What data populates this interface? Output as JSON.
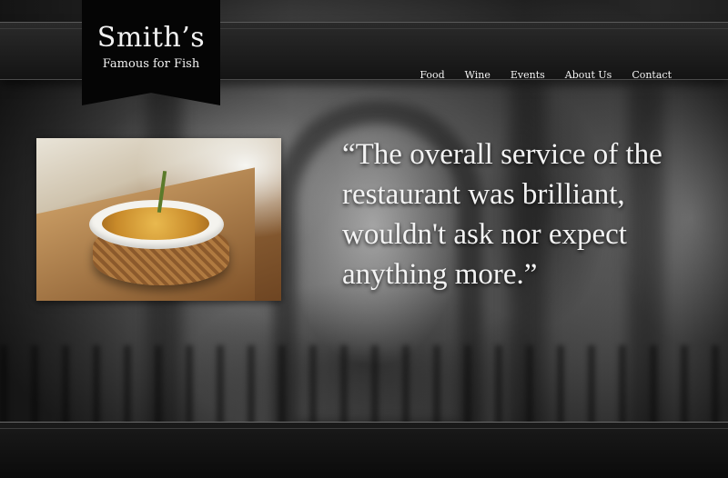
{
  "brand": {
    "name": "Smith’s",
    "tagline": "Famous for Fish"
  },
  "nav": {
    "items": [
      {
        "label": "Food"
      },
      {
        "label": "Wine"
      },
      {
        "label": "Events"
      },
      {
        "label": "About Us"
      },
      {
        "label": "Contact"
      }
    ]
  },
  "hero": {
    "quote_lines": [
      "“The overall service of the",
      "restaurant was brilliant,",
      "wouldn't  ask nor expect",
      "anything more.”"
    ]
  }
}
